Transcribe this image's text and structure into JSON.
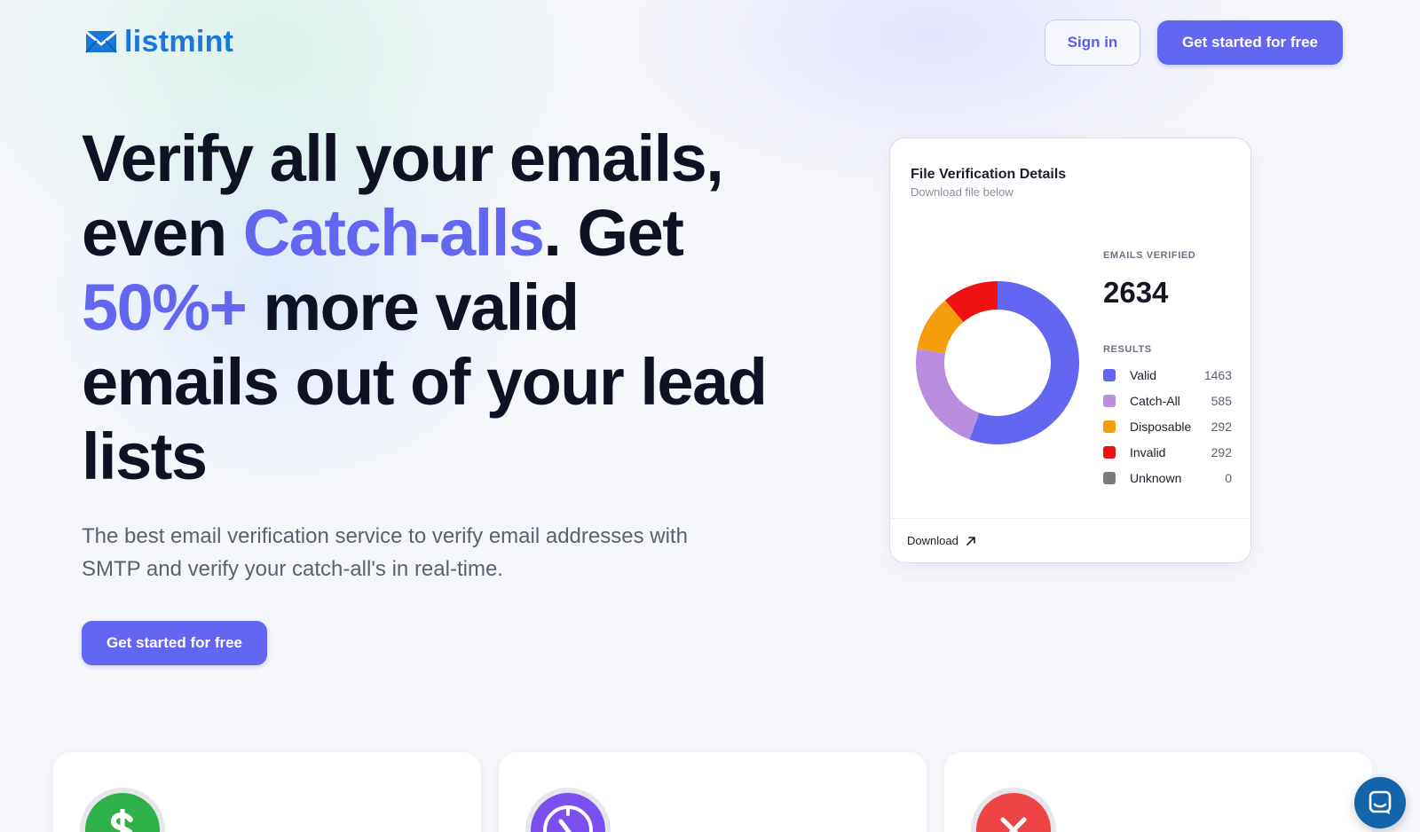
{
  "brand": {
    "name": "listmint",
    "color": "#1877d8",
    "accent": "#6366f1"
  },
  "header": {
    "sign_in": "Sign in",
    "cta": "Get started for free"
  },
  "hero": {
    "title_part1": "Verify all your emails, even ",
    "title_accent1": "Catch-alls",
    "title_part2": ". Get ",
    "title_accent2": "50%+",
    "title_part3": " more valid emails out of your lead lists",
    "subtitle": "The best email verification service to verify email addresses with SMTP and verify your catch-all's in real-time.",
    "cta": "Get started for free"
  },
  "card": {
    "title": "File Verification Details",
    "subtitle": "Download file below",
    "emails_verified_label": "EMAILS VERIFIED",
    "emails_verified_value": "2634",
    "results_label": "RESULTS",
    "download_label": "Download"
  },
  "chart_data": {
    "type": "pie",
    "donut": true,
    "categories": [
      "Valid",
      "Catch-All",
      "Disposable",
      "Invalid",
      "Unknown"
    ],
    "values": [
      1463,
      585,
      292,
      292,
      0
    ],
    "colors": [
      "#6366f1",
      "#b98ee0",
      "#f59e0b",
      "#ee1111",
      "#7a7a7a"
    ],
    "legend": "right"
  },
  "features": [
    {
      "icon": "dollar-icon",
      "color": "#2fb14a"
    },
    {
      "icon": "clock-icon",
      "color": "#7b4ff0"
    },
    {
      "icon": "x-icon",
      "color": "#ef4444"
    }
  ],
  "chat": {
    "icon": "chat-icon",
    "color": "#1364ab"
  }
}
